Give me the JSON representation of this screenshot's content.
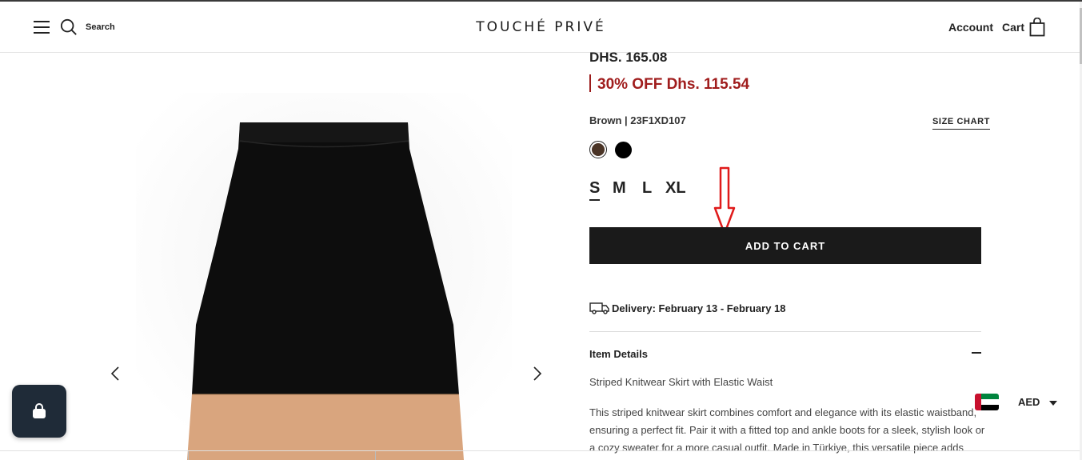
{
  "header": {
    "search_label": "Search",
    "logo_text": "TOUCHÉ PRIVÉ",
    "account_label": "Account",
    "cart_label": "Cart"
  },
  "product": {
    "price_original": "DHS. 165.08",
    "price_sale": "30% OFF Dhs. 115.54",
    "variant_info": "Brown | 23F1XD107",
    "size_chart_label": "SIZE CHART",
    "colors": [
      {
        "name": "Brown",
        "hex": "#4a3426",
        "selected": true
      },
      {
        "name": "Black",
        "hex": "#000000",
        "selected": false
      }
    ],
    "sizes": [
      "S",
      "M",
      "L",
      "XL"
    ],
    "selected_size": "S",
    "add_to_cart_label": "ADD TO CART",
    "delivery_text": "Delivery: February 13 - February 18",
    "details_heading": "Item Details",
    "details_title": "Striped Knitwear Skirt with Elastic Waist",
    "details_body": "This striped knitwear skirt combines comfort and elegance with its elastic waistband, ensuring a perfect fit. Pair it with a fitted top and ankle boots for a sleek, stylish look or a cozy sweater for a more casual outfit. Made in Türkiye, this versatile piece adds"
  },
  "currency": {
    "code": "AED"
  },
  "colors": {
    "sale_red": "#a01d1d",
    "button_bg": "#1a1a1a",
    "chat_bg": "#1f2b38",
    "skirt_black": "#0d0d0d",
    "skirt_tan": "#d9a57e"
  }
}
